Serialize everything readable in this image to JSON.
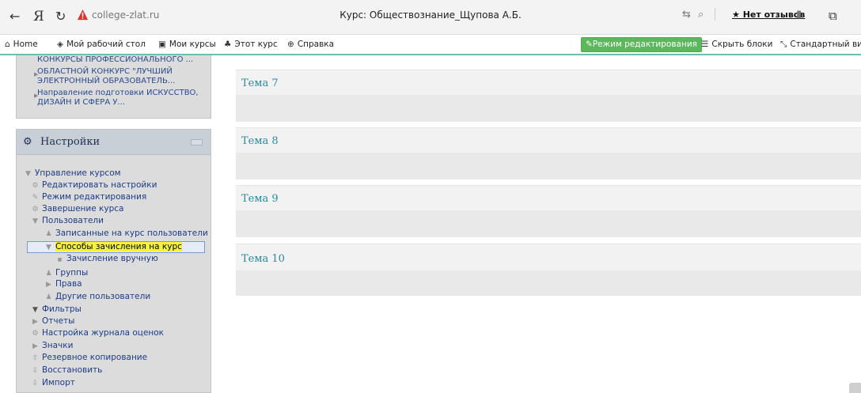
{
  "browser": {
    "address": "college-zlat.ru",
    "page_title": "Курс: Обществознание_Щупова А.Б.",
    "reviews_label": "★ Нет отзывов"
  },
  "navbar": {
    "home": "Home",
    "dashboard": "Мой рабочий стол",
    "my_courses": "Мои курсы",
    "this_course": "Этот курс",
    "help": "Справка",
    "edit_mode": "Режим редактирования",
    "hide_blocks": "Скрыть блоки",
    "standard_view": "Стандартный вид"
  },
  "top_block": {
    "items": [
      "КОНКУРСЫ ПРОФЕССИОНАЛЬНОГО ...",
      "ОБЛАСТНОЙ КОНКУРС \"ЛУЧШИЙ",
      "ЭЛЕКТРОННЫЙ ОБРАЗОВАТЕЛЬ...",
      "Направление подготовки ИСКУССТВО,",
      "ДИЗАЙН И СФЕРА У..."
    ]
  },
  "settings": {
    "title": "Настройки",
    "tree": [
      "Управление курсом",
      "Редактировать настройки",
      "Режим редактирования",
      "Завершение курса",
      "Пользователи",
      "Записанные на курс пользователи",
      "Способы зачисления на курс",
      "Зачисление вручную",
      "Группы",
      "Права",
      "Другие пользователи",
      "Фильтры",
      "Отчеты",
      "Настройка журнала оценок",
      "Значки",
      "Резервное копирование",
      "Восстановить",
      "Импорт"
    ]
  },
  "topics": [
    {
      "name": "Тема 7"
    },
    {
      "name": "Тема 8"
    },
    {
      "name": "Тема 9"
    },
    {
      "name": "Тема 10"
    }
  ]
}
